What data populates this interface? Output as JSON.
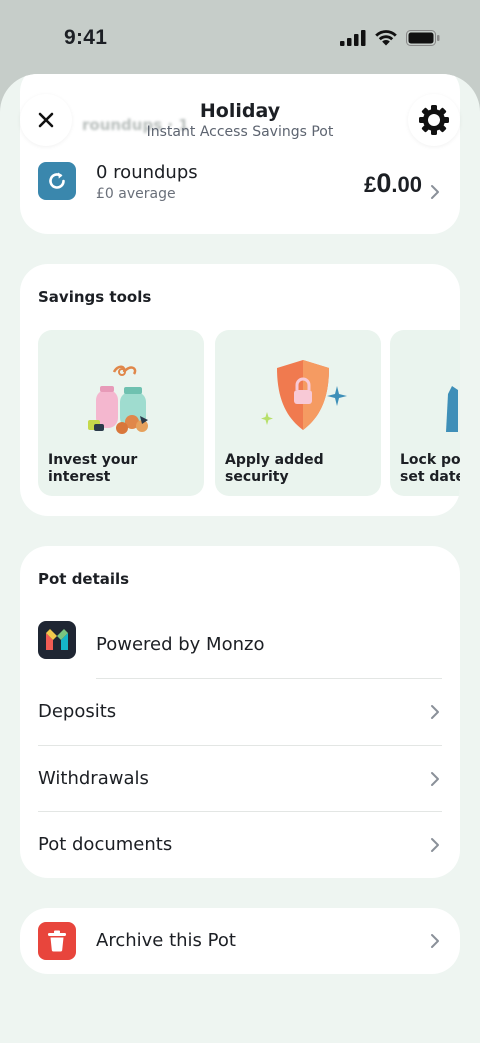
{
  "status_bar": {
    "time": "9:41"
  },
  "header": {
    "title": "Holiday",
    "subtitle": "Instant Access Savings Pot",
    "ghost_text": "roundups · 1"
  },
  "roundups": {
    "title": "0 roundups",
    "subtitle": "£0 average",
    "currency": "£",
    "amount_major": "0",
    "amount_minor": ".00"
  },
  "savings_tools": {
    "title": "Savings tools",
    "tiles": [
      {
        "label": "Invest your interest"
      },
      {
        "label": "Apply added security"
      },
      {
        "label": "Lock pot set date"
      }
    ]
  },
  "pot_details": {
    "title": "Pot details",
    "powered_by": "Powered by Monzo",
    "rows": [
      {
        "label": "Deposits"
      },
      {
        "label": "Withdrawals"
      },
      {
        "label": "Pot documents"
      }
    ]
  },
  "archive": {
    "label": "Archive this Pot"
  },
  "colors": {
    "background": "#eef5f1",
    "roundup_icon": "#3a87ad",
    "monzo_icon": "#1f2633",
    "archive_icon": "#e8453c",
    "tile": "#eaf4ee"
  },
  "icons": {
    "close": "close-icon",
    "settings": "gear-icon",
    "roundup": "refresh-icon",
    "monzo": "monzo-logo-icon",
    "archive": "trash-icon",
    "chevron": "chevron-right-icon"
  }
}
